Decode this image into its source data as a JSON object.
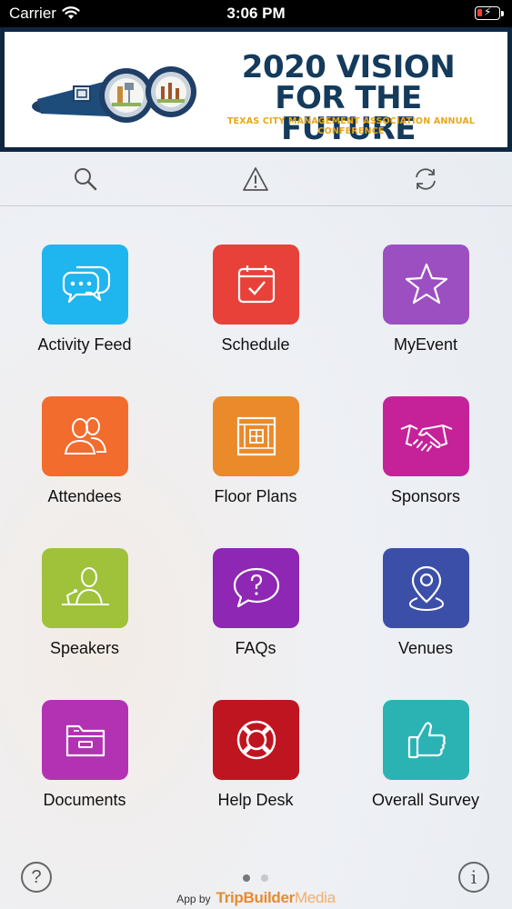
{
  "status_bar": {
    "carrier": "Carrier",
    "time": "3:06 PM"
  },
  "banner": {
    "title_line1": "2020 VISION",
    "title_line2": "FOR THE FUTURE",
    "subtitle": "TEXAS CITY MANAGEMENT ASSOCIATION ANNUAL CONFERENCE"
  },
  "toolbar": {
    "icons": [
      "search-icon",
      "alert-icon",
      "sync-icon"
    ]
  },
  "tiles": [
    {
      "label": "Activity Feed",
      "color": "#1fb5ee",
      "icon": "chat-bubbles-icon"
    },
    {
      "label": "Schedule",
      "color": "#e8413a",
      "icon": "calendar-check-icon"
    },
    {
      "label": "MyEvent",
      "color": "#9c4fc1",
      "icon": "star-icon"
    },
    {
      "label": "Attendees",
      "color": "#f26c2e",
      "icon": "people-icon"
    },
    {
      "label": "Floor Plans",
      "color": "#ea8a2b",
      "icon": "floor-plan-icon"
    },
    {
      "label": "Sponsors",
      "color": "#c5229a",
      "icon": "handshake-icon"
    },
    {
      "label": "Speakers",
      "color": "#9fc23a",
      "icon": "speaker-podium-icon"
    },
    {
      "label": "FAQs",
      "color": "#8e27b3",
      "icon": "question-bubble-icon"
    },
    {
      "label": "Venues",
      "color": "#3b4fa8",
      "icon": "map-pin-icon"
    },
    {
      "label": "Documents",
      "color": "#b232b3",
      "icon": "folder-icon"
    },
    {
      "label": "Help Desk",
      "color": "#bf1520",
      "icon": "lifebuoy-icon"
    },
    {
      "label": "Overall Survey",
      "color": "#2bb3b4",
      "icon": "thumbs-up-icon"
    }
  ],
  "footer": {
    "help_symbol": "?",
    "info_symbol": "i",
    "credit_prefix": "App by",
    "brand_main": "TripBuilder",
    "brand_suffix": "Media",
    "page_dots": {
      "count": 2,
      "active": 1
    }
  }
}
